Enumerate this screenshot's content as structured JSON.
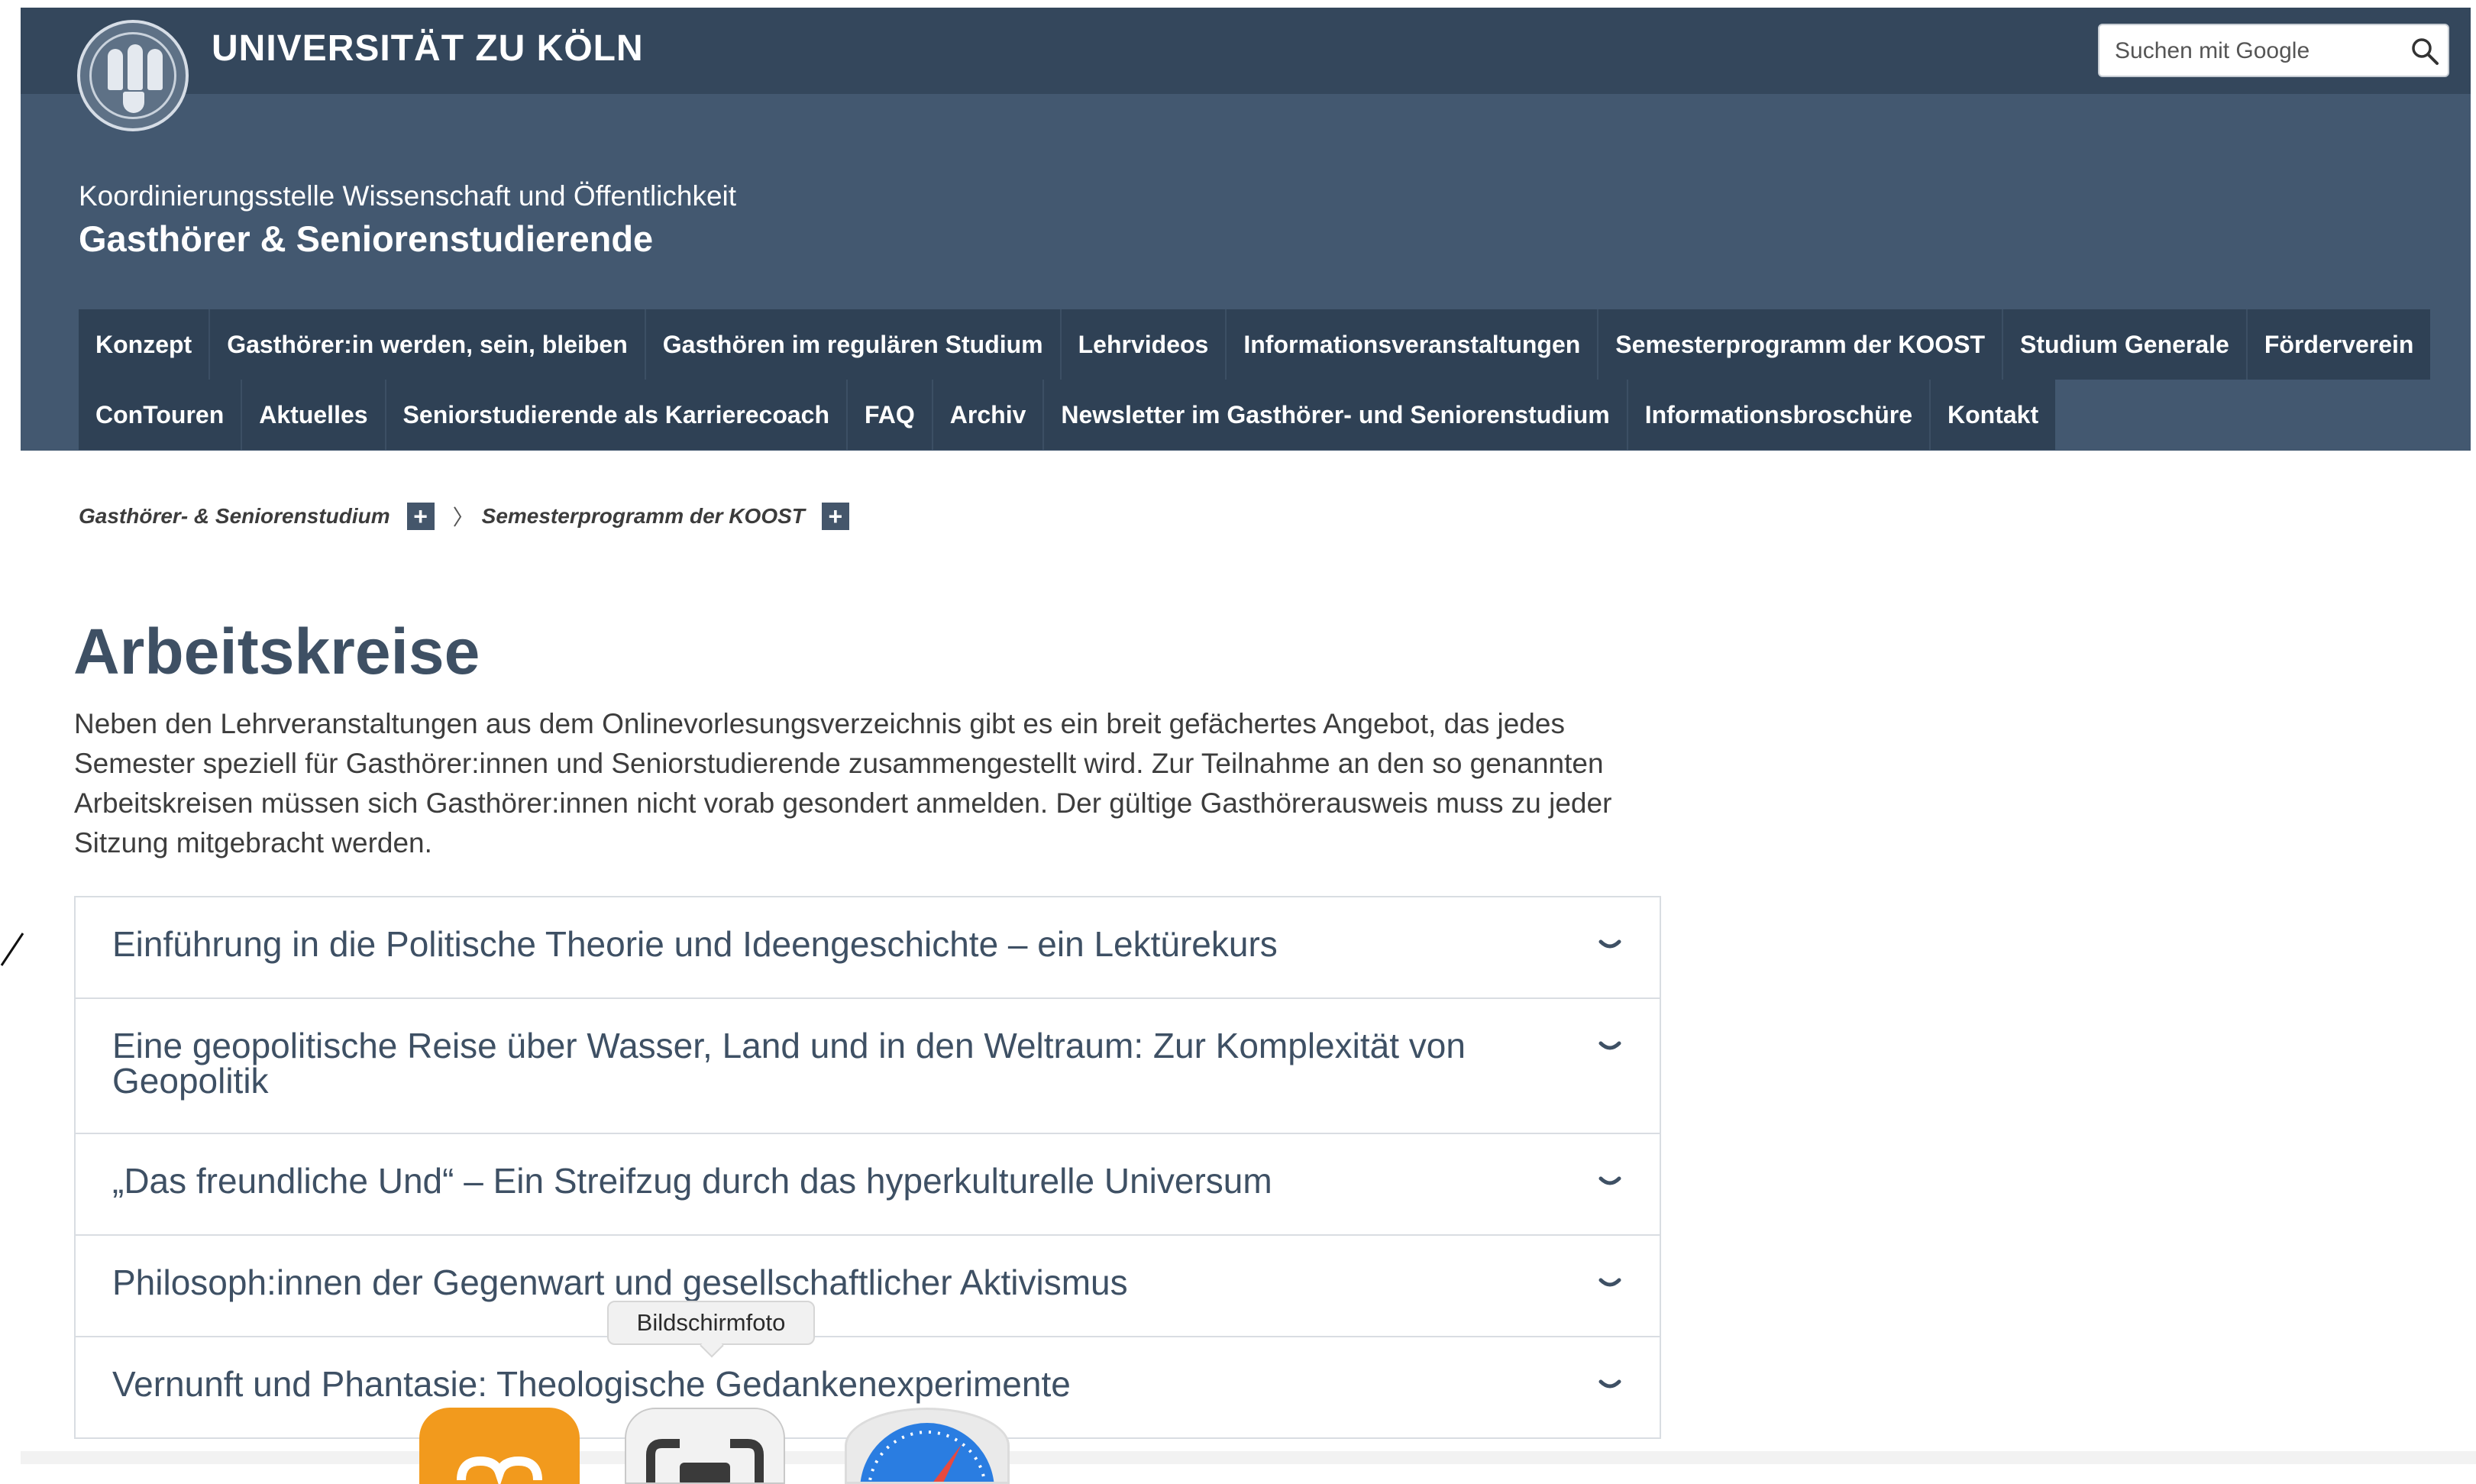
{
  "header": {
    "university": "UNIVERSITÄT ZU KÖLN",
    "department": "Koordinierungsstelle Wissenschaft und Öffentlichkeit",
    "site_title": "Gasthörer & Seniorenstudierende"
  },
  "search": {
    "placeholder": "Suchen mit Google",
    "value": ""
  },
  "nav": {
    "row1": [
      "Konzept",
      "Gasthörer:in werden, sein, bleiben",
      "Gasthören im regulären Studium",
      "Lehrvideos",
      "Informationsveranstaltungen",
      "Semesterprogramm der KOOST",
      "Studium Generale",
      "Förderverein"
    ],
    "row2": [
      "ConTouren",
      "Aktuelles",
      "Seniorstudierende als Karrierecoach",
      "FAQ",
      "Archiv",
      "Newsletter im Gasthörer- und Seniorenstudium",
      "Informationsbroschüre",
      "Kontakt"
    ]
  },
  "breadcrumb": {
    "items": [
      "Gasthörer- & Seniorenstudium",
      "Semesterprogramm der KOOST"
    ],
    "separator": "〉",
    "expand": "+"
  },
  "main": {
    "title": "Arbeitskreise",
    "intro": "Neben den Lehrveranstaltungen aus dem Onlinevorlesungsverzeichnis gibt es ein breit gefächertes Angebot, das jedes Semester speziell für Gasthörer:innen und Seniorstudierende zusammengestellt wird. Zur Teilnahme an den so genannten Arbeitskreisen müssen sich Gasthörer:innen nicht vorab gesondert anmelden. Der gültige Gasthörerausweis muss zu jeder Sitzung mitgebracht werden.",
    "accordion": [
      "Einführung in die Politische Theorie und Ideengeschichte – ein Lektürekurs",
      "Eine geopolitische Reise über Wasser, Land und in den Weltraum: Zur Komplexität von Geopolitik",
      "„Das freundliche Und“ – Ein Streifzug durch das hyperkulturelle Universum",
      "Philosoph:innen der Gegenwart und gesellschaftlicher Aktivismus",
      "Vernunft und Phantasie: Theologische Gedankenexperimente"
    ]
  },
  "dock": {
    "tooltip": "Bildschirmfoto"
  },
  "colors": {
    "header": "#435870",
    "top_bar": "#34475c",
    "nav": "#2f4155",
    "title": "#3e5064"
  }
}
